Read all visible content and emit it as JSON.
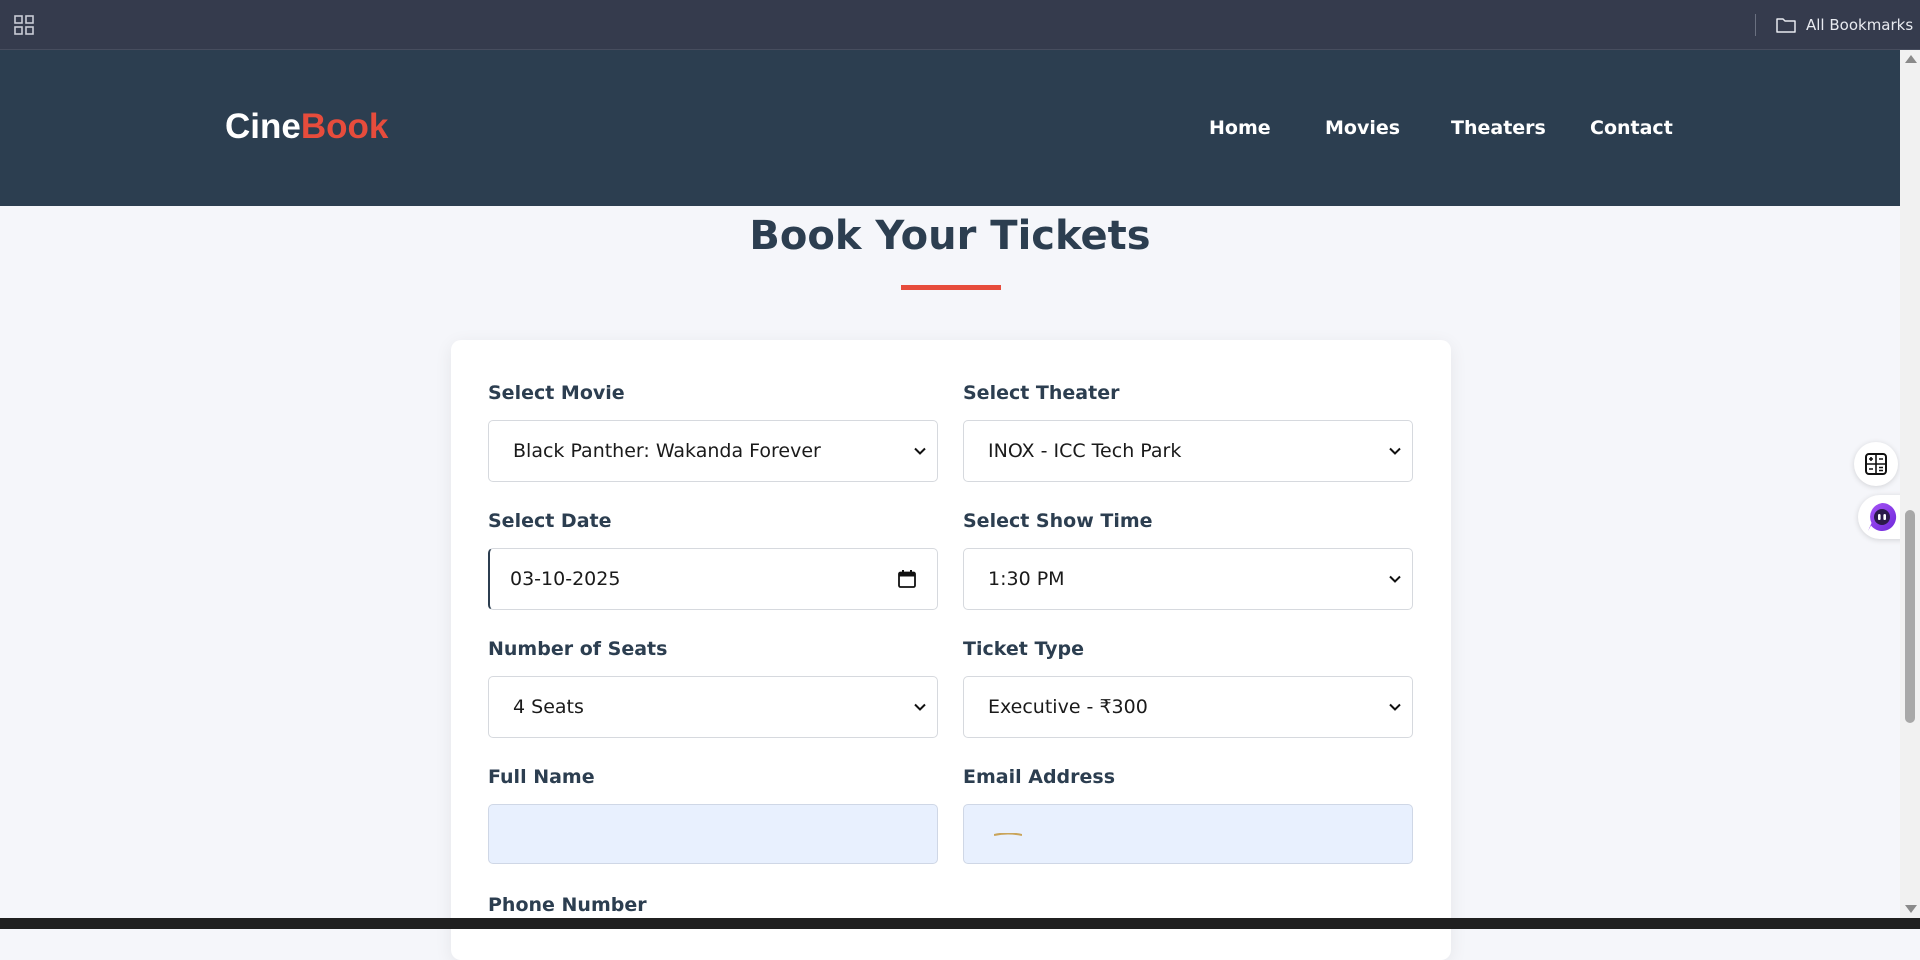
{
  "browser": {
    "all_bookmarks_label": "All Bookmarks"
  },
  "site": {
    "logo_part1": "Cine",
    "logo_part2": "Book",
    "accent_color": "#e74c3c",
    "header_color": "#2c3e50",
    "nav": [
      {
        "label": "Home"
      },
      {
        "label": "Movies"
      },
      {
        "label": "Theaters"
      },
      {
        "label": "Contact"
      }
    ]
  },
  "page": {
    "title": "Book Your Tickets"
  },
  "form": {
    "movie": {
      "label": "Select Movie",
      "value": "Black Panther: Wakanda Forever"
    },
    "theater": {
      "label": "Select Theater",
      "value": "INOX - ICC Tech Park"
    },
    "date": {
      "label": "Select Date",
      "value": "03-10-2025"
    },
    "show_time": {
      "label": "Select Show Time",
      "value": "1:30 PM"
    },
    "seats": {
      "label": "Number of Seats",
      "value": "4 Seats"
    },
    "ticket_type": {
      "label": "Ticket Type",
      "value": "Executive - ₹300"
    },
    "full_name": {
      "label": "Full Name",
      "value": ""
    },
    "email": {
      "label": "Email Address",
      "value": ""
    },
    "phone": {
      "label": "Phone Number"
    }
  },
  "icons": {
    "apps": "grid-icon",
    "bookmarks": "folder-icon",
    "calendar": "calendar-icon",
    "calculator": "calculator-icon",
    "assistant": "assistant-icon"
  }
}
